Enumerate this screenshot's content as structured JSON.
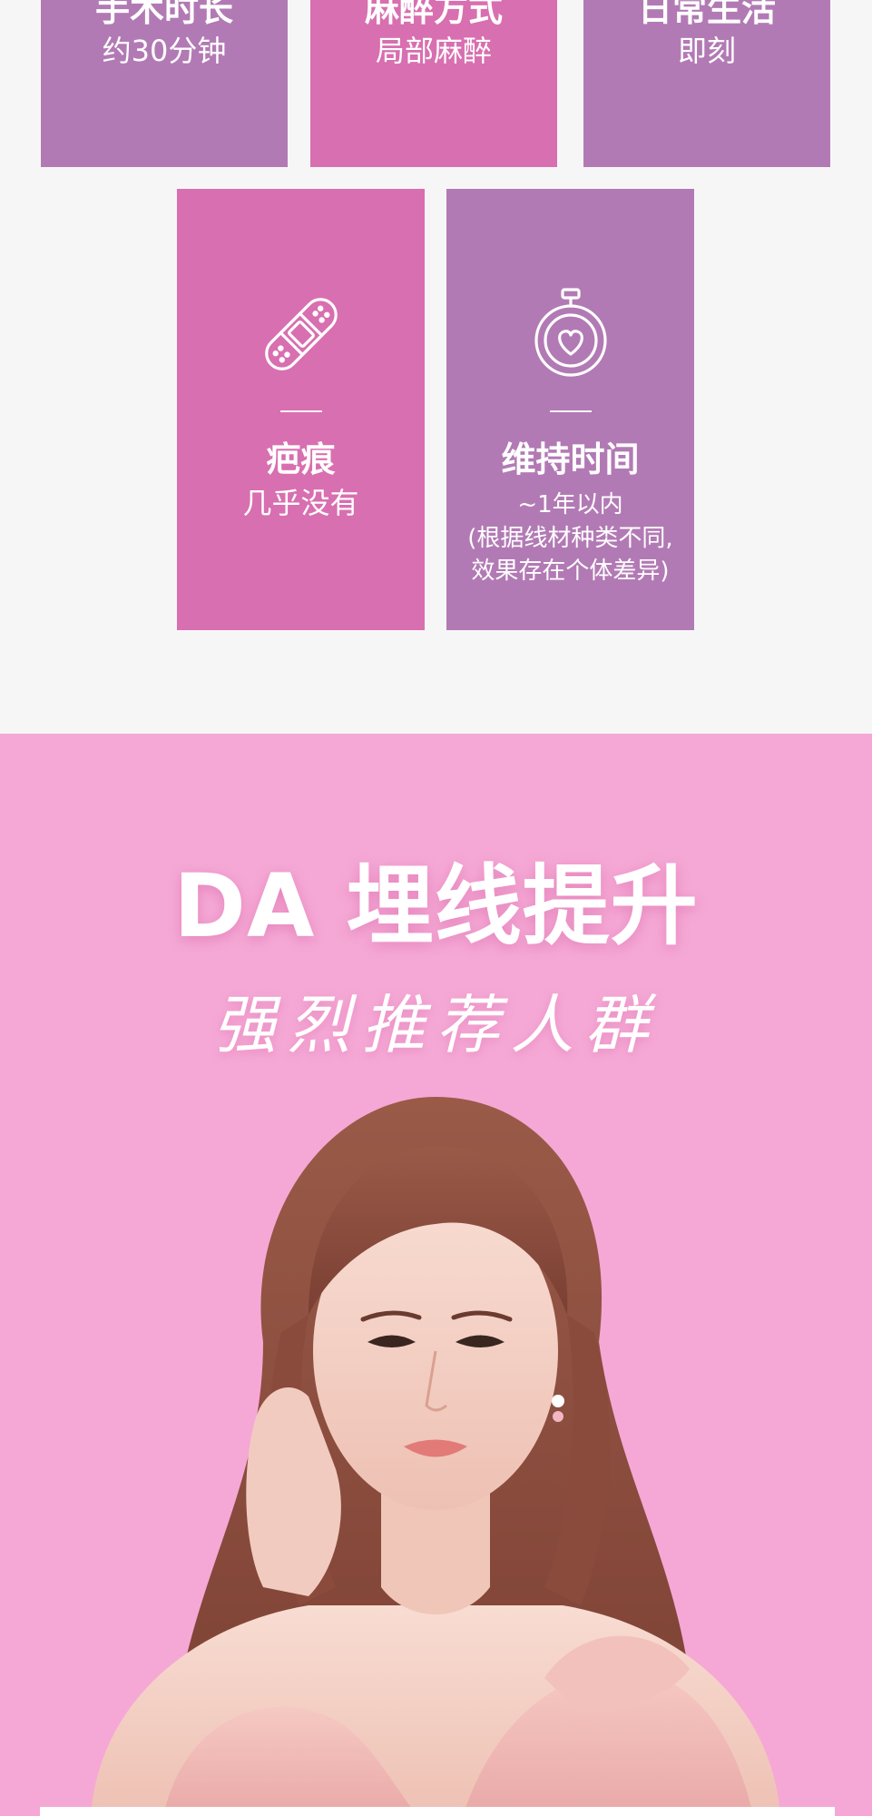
{
  "colors": {
    "card_purple": "#b27ab4",
    "card_pink": "#d86fb0",
    "page_background": "#f7f6f7",
    "pink_section": "#f5a8d5",
    "text_white": "#ffffff"
  },
  "cards_top": [
    {
      "title": "手术时长",
      "value": "约30分钟"
    },
    {
      "title": "麻醉方式",
      "value": "局部麻醉"
    },
    {
      "title": "日常生活",
      "value": "即刻"
    }
  ],
  "cards_bottom": [
    {
      "icon": "bandage-icon",
      "title": "疤痕",
      "value": "几乎没有"
    },
    {
      "icon": "stopwatch-heart-icon",
      "title": "维持时间",
      "value_lines": [
        "~1年以内",
        "(根据线材种类不同,",
        "效果存在个体差异)"
      ]
    }
  ],
  "promo": {
    "headline": "DA 埋线提升",
    "subheadline": "强烈推荐人群"
  }
}
